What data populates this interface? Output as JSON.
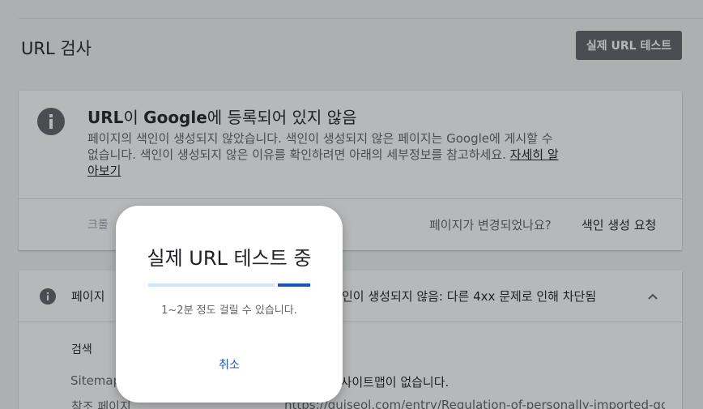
{
  "page": {
    "title": "URL 검사",
    "live_test_button": "실제 URL 테스트"
  },
  "status_card": {
    "title_part1": "URL",
    "title_part2": "이 ",
    "title_part3": "Google",
    "title_part4": "에 등록되어 있지 않음",
    "description": "페이지의 색인이 생성되지 않았습니다. 색인이 생성되지 않은 페이지는 Google에 게시할 수 없습니다. 색인이 생성되지 않은 이유를 확인하려면 아래의 세부정보를 참고하세요.",
    "learn_more": "자세히 알아보기",
    "crawl_label": "크롤",
    "page_changed_question": "페이지가 변경되었나요?",
    "request_indexing": "색인 생성 요청"
  },
  "detail_card": {
    "title_left": "페이지",
    "title_right": "인이 생성되지 않음: 다른 4xx 문제로 인해 차단됨",
    "section_heading": "검색",
    "sitemap_label": "Sitemap",
    "sitemap_value": "조 사이트맵이 없습니다.",
    "referrer_label": "참조 페이지",
    "referrer_value": "https://guiseol.com/entry/Regulation-of-personally-imported-goo"
  },
  "dialog": {
    "title": "실제 URL 테스트 중",
    "message": "1~2분 정도 걸릴 수 있습니다.",
    "cancel": "취소",
    "progress": 0.2
  },
  "colors": {
    "accent": "#1a56b5",
    "progress_track": "#d2e3fc",
    "button_bg": "#5f6368"
  },
  "icons": {
    "status": "info-icon",
    "detail": "info-icon",
    "collapse": "chevron-up-icon"
  }
}
